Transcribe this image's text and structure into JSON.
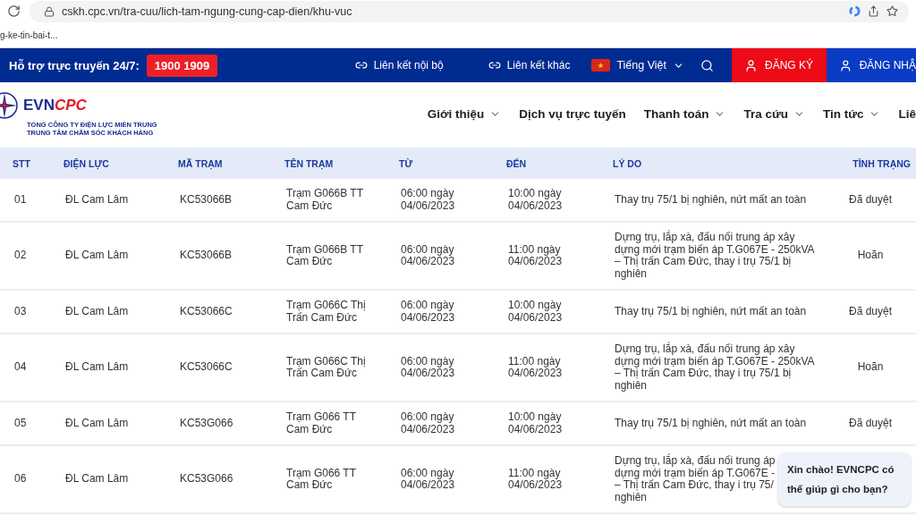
{
  "browser": {
    "url": "cskh.cpc.vn/tra-cuu/lich-tam-ngung-cung-cap-dien/khu-vuc",
    "bookmark": "g-ke-tin-bai-t..."
  },
  "topbar": {
    "hotline_label": "Hỗ trợ trực truyến 24/7:",
    "hotline": "1900 1909",
    "links": [
      "Liên kết nội bộ",
      "Liên kết khác"
    ],
    "language": "Tiếng Việt",
    "register": "ĐĂNG KÝ",
    "login": "ĐĂNG NHẬ"
  },
  "header": {
    "logo_left": "EVN",
    "logo_right": "CPC",
    "org": "TỔNG CÔNG TY ĐIỆN LỰC MIỀN TRUNG",
    "center": "TRUNG TÂM CHĂM SÓC KHÁCH HÀNG",
    "nav": [
      {
        "label": "Giới thiệu",
        "dropdown": true
      },
      {
        "label": "Dịch vụ trực tuyến",
        "dropdown": false
      },
      {
        "label": "Thanh toán",
        "dropdown": true
      },
      {
        "label": "Tra cứu",
        "dropdown": true
      },
      {
        "label": "Tin tức",
        "dropdown": true
      },
      {
        "label": "Liê",
        "dropdown": false
      }
    ]
  },
  "table": {
    "columns": [
      "STT",
      "ĐIỆN LỰC",
      "MÃ TRẠM",
      "TÊN TRẠM",
      "TỪ",
      "ĐẾN",
      "LÝ DO",
      "TÌNH TRẠNG"
    ],
    "rows": [
      {
        "stt": "01",
        "dien_luc": "ĐL Cam Lâm",
        "ma_tram": "KC53066B",
        "ten_tram": "Trạm G066B TT Cam Đức",
        "tu": "06:00 ngày 04/06/2023",
        "den": "10:00 ngày 04/06/2023",
        "ly_do": [
          "Thay trụ 75/1 bị nghiên, nứt mất an toàn"
        ],
        "tinh_trang": "Đã duyệt"
      },
      {
        "stt": "02",
        "dien_luc": "ĐL Cam Lâm",
        "ma_tram": "KC53066B",
        "ten_tram": "Trạm G066B TT Cam Đức",
        "tu": "06:00 ngày 04/06/2023",
        "den": "11:00 ngày 04/06/2023",
        "ly_do": [
          "Dựng trụ, lắp xà, đấu nối trung áp xây",
          "dựng mới trạm biến áp T.G067E - 250kVA",
          "– Thị trấn Cam Đức, thay i trụ 75/1 bị",
          "nghiên"
        ],
        "tinh_trang": "Hoãn"
      },
      {
        "stt": "03",
        "dien_luc": "ĐL Cam Lâm",
        "ma_tram": "KC53066C",
        "ten_tram": "Trạm G066C Thị Trấn Cam Đức",
        "tu": "06:00 ngày 04/06/2023",
        "den": "10:00 ngày 04/06/2023",
        "ly_do": [
          "Thay trụ 75/1 bị nghiên, nứt mất an toàn"
        ],
        "tinh_trang": "Đã duyệt"
      },
      {
        "stt": "04",
        "dien_luc": "ĐL Cam Lâm",
        "ma_tram": "KC53066C",
        "ten_tram": "Trạm G066C Thị Trấn Cam Đức",
        "tu": "06:00 ngày 04/06/2023",
        "den": "11:00 ngày 04/06/2023",
        "ly_do": [
          "Dựng trụ, lắp xà, đấu nối trung áp xây",
          "dựng mới trạm biến áp T.G067E - 250kVA",
          "– Thị trấn Cam Đức, thay i trụ 75/1 bị",
          "nghiên"
        ],
        "tinh_trang": "Hoãn"
      },
      {
        "stt": "05",
        "dien_luc": "ĐL Cam Lâm",
        "ma_tram": "KC53G066",
        "ten_tram": "Trạm G066 TT Cam Đức",
        "tu": "06:00 ngày 04/06/2023",
        "den": "10:00 ngày 04/06/2023",
        "ly_do": [
          "Thay trụ 75/1 bị nghiên, nứt mất an toàn"
        ],
        "tinh_trang": "Đã duyệt"
      },
      {
        "stt": "06",
        "dien_luc": "ĐL Cam Lâm",
        "ma_tram": "KC53G066",
        "ten_tram": "Trạm G066 TT Cam Đức",
        "tu": "06:00 ngày 04/06/2023",
        "den": "11:00 ngày 04/06/2023",
        "ly_do": [
          "Dựng trụ, lắp xà, đấu nối trung áp",
          "dựng mới trạm biến áp T.G067E -",
          "– Thị trấn Cam Đức, thay i trụ 75/",
          "nghiên"
        ]
      }
    ]
  },
  "chat": {
    "message": "Xin chào! EVNCPC có thể giúp gì cho bạn?"
  }
}
